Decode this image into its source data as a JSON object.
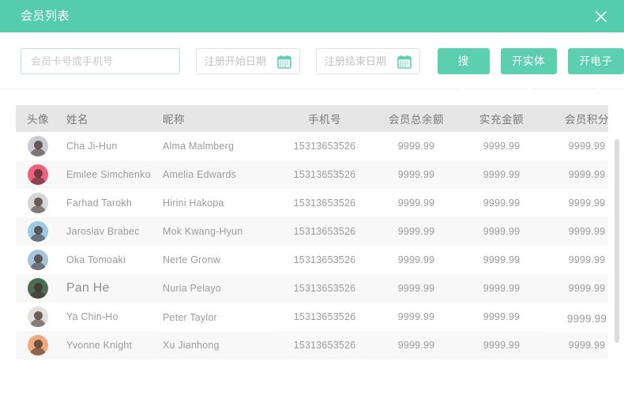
{
  "titlebar": {
    "title": "会员列表",
    "close_label": "×",
    "bg_color": "#55CDAA"
  },
  "toolbar": {
    "keyword_value": "",
    "keyword_placeholder": "会员卡号或手机号",
    "start_date_value": "",
    "start_date_placeholder": "注册开始日期",
    "end_date_value": "",
    "end_date_placeholder": "注册结束日期",
    "search_label": "搜索",
    "physical_card_label": "开实体卡",
    "electronic_card_label": "开电子卡",
    "button_color": "#5BCFAE"
  },
  "table": {
    "columns": [
      "头像",
      "姓名",
      "昵称",
      "手机号",
      "会员总余额",
      "实充金额",
      "会员积分"
    ],
    "rows": [
      {
        "name": "Cha Ji-Hun",
        "nickname": "Alma Malmberg",
        "phone": "15313653526",
        "balance": "9999.99",
        "charge": "9999.99",
        "points": "9999.99",
        "avatar_bg": "#c9cdd2"
      },
      {
        "name": "Emilee Simchenko",
        "nickname": "Amelia Edwards",
        "phone": "15313653526",
        "balance": "9999.99",
        "charge": "9999.99",
        "points": "9999.99",
        "avatar_bg": "#f2607f"
      },
      {
        "name": "Farhad Tarokh",
        "nickname": "Hirini Hakopa",
        "phone": "15313653526",
        "balance": "9999.99",
        "charge": "9999.99",
        "points": "9999.99",
        "avatar_bg": "#d5d7d8"
      },
      {
        "name": "Jaroslav Brabec",
        "nickname": "Mok Kwang-Hyun",
        "phone": "15313653526",
        "balance": "9999.99",
        "charge": "9999.99",
        "points": "9999.99",
        "avatar_bg": "#9ec9e2"
      },
      {
        "name": "Oka Tomoaki",
        "nickname": "Nerte Gronw",
        "phone": "15313653526",
        "balance": "9999.99",
        "charge": "9999.99",
        "points": "9999.99",
        "avatar_bg": "#a8c4dd"
      },
      {
        "name": "Pan He",
        "nickname": "Nuria Pelayo",
        "phone": "15313653526",
        "balance": "9999.99",
        "charge": "9999.99",
        "points": "9999.99",
        "avatar_bg": "#4f6b52"
      },
      {
        "name": "Ya Chin-Ho",
        "nickname": "Peter Taylor",
        "phone": "15313653526",
        "balance": "9999.99",
        "charge": "9999.99",
        "points": "9999.99",
        "avatar_bg": "#e3e0dc"
      },
      {
        "name": "Yvonne Knight",
        "nickname": "Xu Jianhong",
        "phone": "15313653526",
        "balance": "9999.99",
        "charge": "9999.99",
        "points": "9999.99",
        "avatar_bg": "#f0a97f"
      }
    ]
  }
}
